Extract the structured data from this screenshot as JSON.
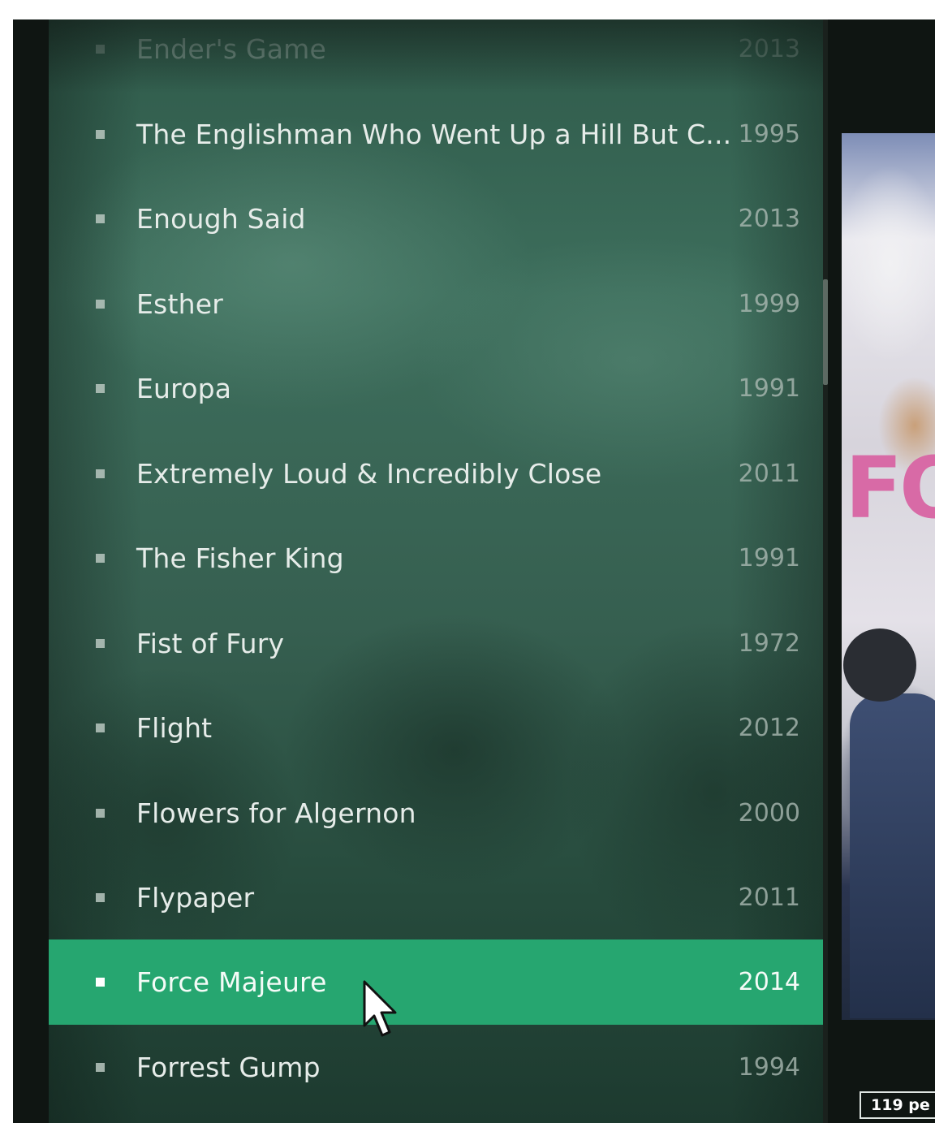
{
  "movie_list": {
    "items": [
      {
        "title": "Ender's Game",
        "year": "2013"
      },
      {
        "title": "The Englishman Who Went Up a Hill But C...",
        "year": "1995"
      },
      {
        "title": "Enough Said",
        "year": "2013"
      },
      {
        "title": "Esther",
        "year": "1999"
      },
      {
        "title": "Europa",
        "year": "1991"
      },
      {
        "title": "Extremely Loud & Incredibly Close",
        "year": "2011"
      },
      {
        "title": "The Fisher King",
        "year": "1991"
      },
      {
        "title": "Fist of Fury",
        "year": "1972"
      },
      {
        "title": "Flight",
        "year": "2012"
      },
      {
        "title": "Flowers for Algernon",
        "year": "2000"
      },
      {
        "title": "Flypaper",
        "year": "2011"
      },
      {
        "title": "Force Majeure",
        "year": "2014"
      },
      {
        "title": "Forrest Gump",
        "year": "1994"
      }
    ],
    "selected_index": 11,
    "selected_color": "#26a670"
  },
  "poster": {
    "title_text": "FO",
    "title_color": "#d86aa6"
  },
  "footer": {
    "pages_label": "119 pe"
  },
  "icons": {
    "bullet": "square-bullet-icon",
    "cursor": "mouse-pointer-icon"
  }
}
